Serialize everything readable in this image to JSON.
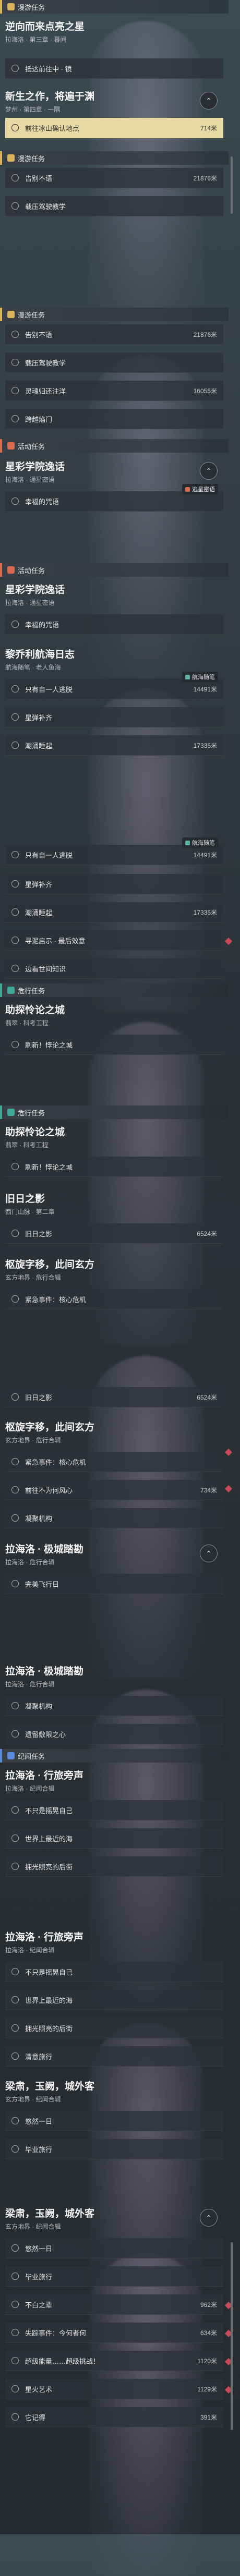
{
  "screen_title": "任务追踪列表",
  "categories": {
    "manhunt": "漫游任务",
    "daily": "漫游任务",
    "activity": "活动任务",
    "explore": "危行任务",
    "legend": "纪闻任务"
  },
  "quests": {
    "q1": {
      "title": "逆向而来点亮之星",
      "subtitle": "拉海洛 · 第三章 · 暮间"
    },
    "q2": {
      "title": "新生之作，将遍于渊",
      "subtitle": "梦州 · 第四章 · 一隅"
    },
    "q3": {
      "title": "星彩学院逸话",
      "subtitle": "拉海洛 · 通星密语"
    },
    "q4": {
      "title": "黎乔利航海日志",
      "subtitle": "航海随笔 · 老人鱼海"
    },
    "q5": {
      "title": "助探怜论之城",
      "subtitle": "翡翠 · 科考工程"
    },
    "q6": {
      "title": "旧日之影",
      "subtitle": "西门山脉 · 第二章"
    },
    "q7": {
      "title": "枢旋字移，此间玄方",
      "subtitle": "玄方地界 · 危行合辑"
    },
    "q8": {
      "title": "拉海洛 · 极城踏勘",
      "subtitle": "拉海洛 · 危行合辑"
    },
    "q9": {
      "title": "拉海洛 · 行旅旁声",
      "subtitle": "拉海洛 · 纪闻合辑"
    },
    "q10": {
      "title": "梁肃，玉阙，城外客",
      "subtitle": "玄方地界 · 纪闻合辑"
    }
  },
  "objectives": {
    "o1": "抵达前往中 · 镜",
    "o2": "前往冰山确认地点",
    "o3": "告别不语",
    "o4": "载压驾驶教学",
    "o5": "灵魂归还注洋",
    "o6": "跨越焰门",
    "o7": "幸福的咒语",
    "o8": "只有自一人逃脱",
    "o9": "星弹补齐",
    "o10": "潮涌睡起",
    "o11": "寻泥启示 · 最后效意",
    "o12": "边看世间知识",
    "o13": "刷新！悖论之城",
    "o14": "旧日之影",
    "o15": "紧急事件：核心危机",
    "o16": "前往不为何风心",
    "o17": "凝聚机构",
    "o18": "完美飞行日",
    "o19": "凝聚机构",
    "o20": "遗留敷限之心",
    "o21": "不只是摇晃自己",
    "o22": "世界上最近的海",
    "o23": "拥光照亮的后街",
    "o24": "清意旅行",
    "o25": "悠然一日",
    "o26": "毕业旅行",
    "o27": "不白之辈",
    "o28": "失踪事件：今何者何",
    "o29": "超级能量……超级挑战！",
    "o30": "星火艺术",
    "o31": "它记得"
  },
  "distances": {
    "d1": "714米",
    "d2": "21876米",
    "d3": "16055米",
    "d4": "14491米",
    "d5": "17335米",
    "d6": "6524米",
    "d7": "734米",
    "d8": "1124米",
    "d9": "962米",
    "d10": "634米",
    "d11": "1120米",
    "d12": "1129米",
    "d13": "391米"
  },
  "tags": {
    "cross": "逃星密语",
    "nav": "航海随笔"
  },
  "collapse_glyph": "⌃",
  "expand_glyph": "⌄",
  "colors": {
    "yellow": "#d8b45a",
    "red": "#d86a4f",
    "teal": "#3fa896",
    "blue": "#5b8ad8",
    "selected": "#e7d9a3",
    "marker": "#c84a58"
  }
}
